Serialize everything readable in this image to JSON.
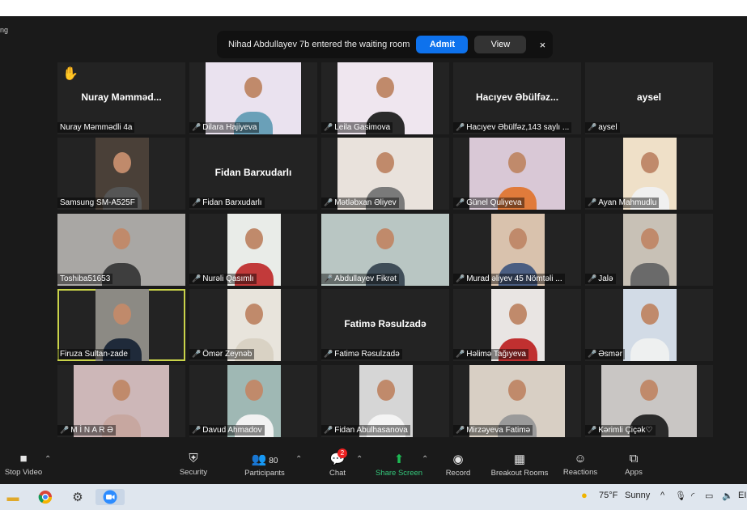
{
  "window": {
    "corner_text": "ng"
  },
  "notification": {
    "message": "Nihad Abdullayev 7b entered the waiting room",
    "admit_label": "Admit",
    "view_label": "View",
    "close_icon": "×"
  },
  "participants": [
    {
      "name": "Nuray Məmmədli 4a",
      "display": "Nuray  Məmməd...",
      "video": false,
      "hand": true
    },
    {
      "name": "Dilara Hajiyeva",
      "video": true
    },
    {
      "name": "Leila Gasimova",
      "video": true
    },
    {
      "name": "Hacıyev Əbülfəz,143 saylı ...",
      "display": "Hacıyev  Əbülfəz...",
      "video": false
    },
    {
      "name": "aysel",
      "display": "aysel",
      "video": false
    },
    {
      "name": "Samsung SM-A525F",
      "video": true
    },
    {
      "name": "Fidan Barxudarlı",
      "display": "Fidan Barxudarlı",
      "video": false
    },
    {
      "name": "Mətləbxan Əliyev",
      "video": true
    },
    {
      "name": "Günel Quliyeva",
      "video": true
    },
    {
      "name": "Ayan Mahmudlu",
      "video": true
    },
    {
      "name": "Toshiba51653",
      "video": true
    },
    {
      "name": "Nurəli Qasımlı",
      "video": true
    },
    {
      "name": "Abdullayev Fikrət",
      "video": true
    },
    {
      "name": "Murad əliyev 45 Nömtəli ...",
      "video": true
    },
    {
      "name": "Jalə",
      "video": true
    },
    {
      "name": "Firuza Sultan-zade",
      "video": true,
      "active": true
    },
    {
      "name": "Ömər Zeynəb",
      "video": true
    },
    {
      "name": "Fatimə Rəsulzadə",
      "display": "Fatimə Rəsulzadə",
      "video": false
    },
    {
      "name": "Həlimə Tağıyeva",
      "video": true
    },
    {
      "name": "Əsmər",
      "video": true
    },
    {
      "name": "M İ N A R Ə",
      "video": true
    },
    {
      "name": "Davud Ahmadov",
      "video": true
    },
    {
      "name": "Fidan Abulhasanova",
      "video": true
    },
    {
      "name": "Mirzəyeva Fatimə",
      "video": true
    },
    {
      "name": "Kərimli Çiçək♡",
      "video": true
    }
  ],
  "toolbar": {
    "stop_video": "Stop Video",
    "security": "Security",
    "participants": "Participants",
    "participants_count": "80",
    "chat": "Chat",
    "chat_badge": "2",
    "share_screen": "Share Screen",
    "record": "Record",
    "breakout_rooms": "Breakout Rooms",
    "reactions": "Reactions",
    "apps": "Apps"
  },
  "taskbar": {
    "weather_temp": "75°F",
    "weather_desc": "Sunny",
    "lang": "EI"
  }
}
